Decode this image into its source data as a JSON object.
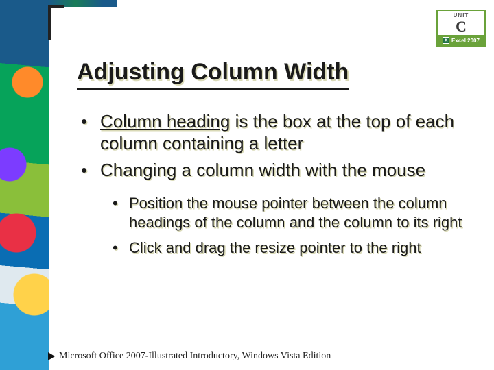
{
  "badge": {
    "unit_label": "UNIT",
    "unit_letter": "C",
    "product": "Excel 2007"
  },
  "title": "Adjusting Column Width",
  "bullets": {
    "b1a_term": "Column heading",
    "b1a_rest": " is the box at the top of each column containing a letter",
    "b1b": "Changing a column width with the mouse",
    "sub1": "Position the mouse pointer between the column headings of the column and the column to its right",
    "sub2": "Click and drag the resize pointer to the right"
  },
  "footer": "Microsoft Office 2007-Illustrated Introductory, Windows Vista Edition"
}
